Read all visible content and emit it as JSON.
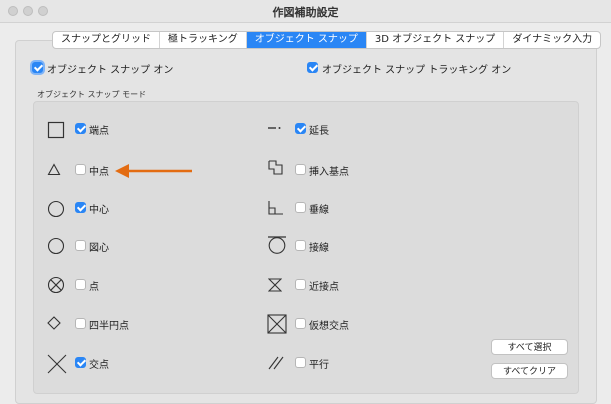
{
  "window": {
    "title": "作図補助設定"
  },
  "tabs": [
    {
      "label": "スナップとグリッド",
      "active": false
    },
    {
      "label": "極トラッキング",
      "active": false
    },
    {
      "label": "オブジェクト スナップ",
      "active": true
    },
    {
      "label": "3D オブジェクト スナップ",
      "active": false
    },
    {
      "label": "ダイナミック入力",
      "active": false
    }
  ],
  "top": {
    "osnap_on": {
      "label": "オブジェクト スナップ オン",
      "checked": true
    },
    "osnap_tracking_on": {
      "label": "オブジェクト スナップ トラッキング オン",
      "checked": true
    }
  },
  "group_title": "オブジェクト スナップ モード",
  "left_modes": [
    {
      "label": "端点",
      "checked": true,
      "icon": "endpoint-square-icon"
    },
    {
      "label": "中点",
      "checked": false,
      "icon": "midpoint-triangle-icon"
    },
    {
      "label": "中心",
      "checked": true,
      "icon": "center-circle-icon"
    },
    {
      "label": "図心",
      "checked": false,
      "icon": "geometric-center-icon"
    },
    {
      "label": "点",
      "checked": false,
      "icon": "node-icon"
    },
    {
      "label": "四半円点",
      "checked": false,
      "icon": "quadrant-diamond-icon"
    },
    {
      "label": "交点",
      "checked": true,
      "icon": "intersection-x-icon"
    }
  ],
  "right_modes": [
    {
      "label": "延長",
      "checked": true,
      "icon": "extension-icon"
    },
    {
      "label": "挿入基点",
      "checked": false,
      "icon": "insertion-icon"
    },
    {
      "label": "垂線",
      "checked": false,
      "icon": "perpendicular-icon"
    },
    {
      "label": "接線",
      "checked": false,
      "icon": "tangent-icon"
    },
    {
      "label": "近接点",
      "checked": false,
      "icon": "nearest-hourglass-icon"
    },
    {
      "label": "仮想交点",
      "checked": false,
      "icon": "apparent-intersection-icon"
    },
    {
      "label": "平行",
      "checked": false,
      "icon": "parallel-icon"
    }
  ],
  "buttons": {
    "select_all": "すべて選択",
    "clear_all": "すべてクリア"
  },
  "colors": {
    "accent": "#2a86f5",
    "annotation_arrow": "#e36c12"
  }
}
